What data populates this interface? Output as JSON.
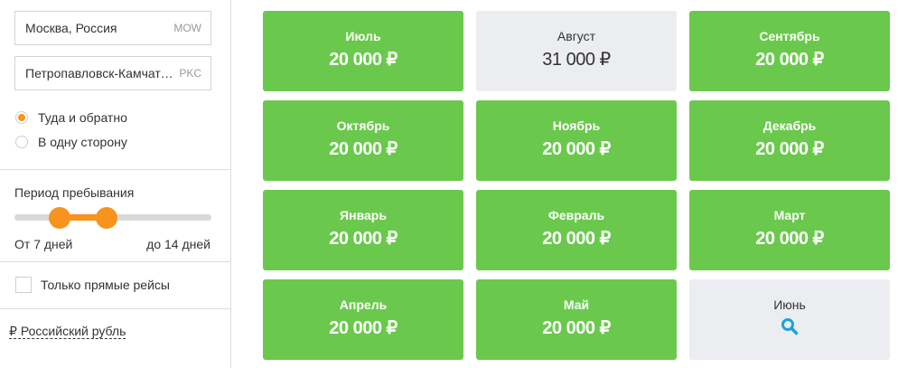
{
  "origin": {
    "city": "Москва, Россия",
    "code": "MOW"
  },
  "destination": {
    "city": "Петропавловск-Камчатский",
    "code": "PKC"
  },
  "trip_type": {
    "options": [
      {
        "label": "Туда и обратно",
        "checked": true
      },
      {
        "label": "В одну сторону",
        "checked": false
      }
    ]
  },
  "stay": {
    "label": "Период пребывания",
    "from_label": "От 7 дней",
    "to_label": "до 14 дней",
    "from_days": 7,
    "to_days": 14,
    "range_start_fraction": 0.23,
    "range_end_fraction": 0.47
  },
  "direct_only": {
    "label": "Только прямые рейсы",
    "checked": false
  },
  "currency": {
    "symbol": "₽",
    "label": "Российский рубль"
  },
  "colors": {
    "accent": "#f7931e",
    "green_card": "#6ac94c",
    "gray_card": "#ecedf0",
    "search_icon": "#1ba3d8"
  },
  "months": [
    {
      "name": "Июль",
      "price": "20 000 ₽",
      "style": "green"
    },
    {
      "name": "Август",
      "price": "31 000 ₽",
      "style": "gray"
    },
    {
      "name": "Сентябрь",
      "price": "20 000 ₽",
      "style": "green"
    },
    {
      "name": "Октябрь",
      "price": "20 000 ₽",
      "style": "green"
    },
    {
      "name": "Ноябрь",
      "price": "20 000 ₽",
      "style": "green"
    },
    {
      "name": "Декабрь",
      "price": "20 000 ₽",
      "style": "green"
    },
    {
      "name": "Январь",
      "price": "20 000 ₽",
      "style": "green"
    },
    {
      "name": "Февраль",
      "price": "20 000 ₽",
      "style": "green"
    },
    {
      "name": "Март",
      "price": "20 000 ₽",
      "style": "green"
    },
    {
      "name": "Апрель",
      "price": "20 000 ₽",
      "style": "green"
    },
    {
      "name": "Май",
      "price": "20 000 ₽",
      "style": "green"
    },
    {
      "name": "Июнь",
      "price": "",
      "style": "gray",
      "icon": "search-icon"
    }
  ]
}
